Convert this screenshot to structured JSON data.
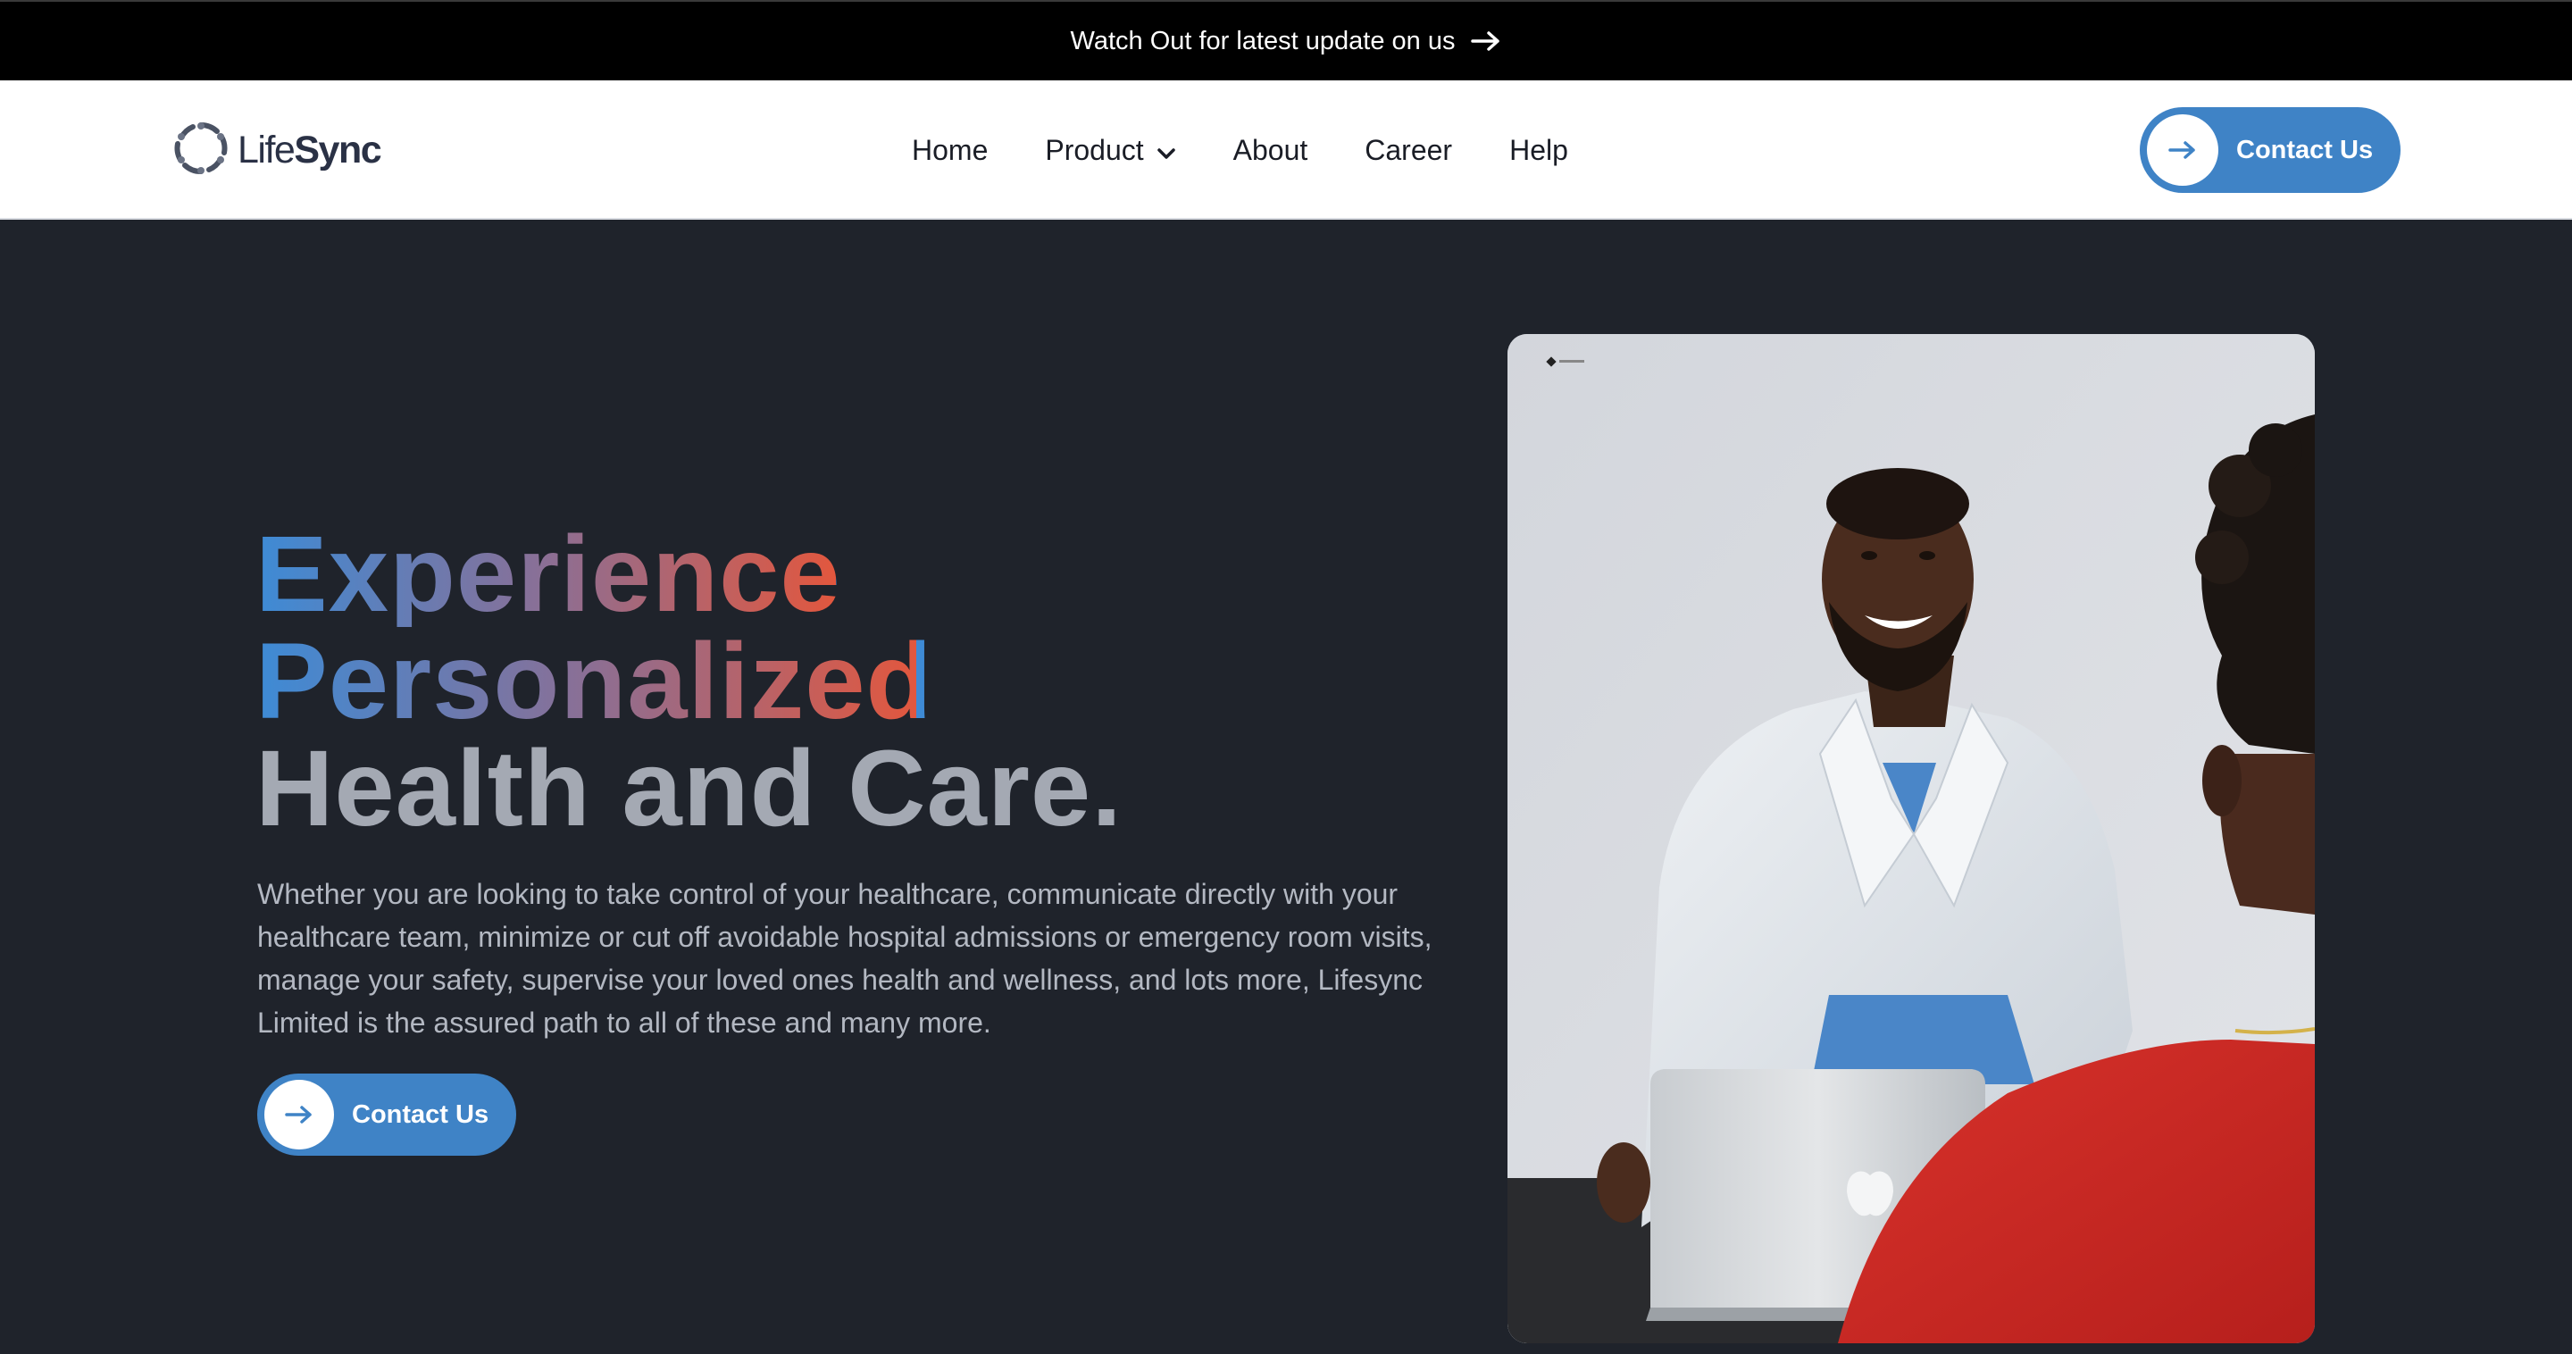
{
  "announcement": {
    "text": "Watch Out for latest update on us",
    "icon": "arrow-right-icon"
  },
  "nav": {
    "logo": {
      "light": "Life",
      "bold": "Sync",
      "icon": "lifesync-logo-icon"
    },
    "menu": [
      {
        "label": "Home"
      },
      {
        "label": "Product",
        "icon": "chevron-down-icon"
      },
      {
        "label": "About"
      },
      {
        "label": "Career"
      },
      {
        "label": "Help"
      }
    ],
    "cta": {
      "label": "Contact Us",
      "icon": "arrow-right-icon"
    }
  },
  "hero": {
    "title_line1": "Experience",
    "title_line2": "Personalized",
    "title_line3": "Health and Care.",
    "description": "Whether you are looking to take control of your healthcare, communicate directly with your healthcare team, minimize or cut off avoidable hospital admissions or emergency room visits, manage your safety, supervise your loved ones health and wellness, and lots more, Lifesync Limited is the assured path to all of these and many more.",
    "cta": {
      "label": "Contact Us",
      "icon": "arrow-right-icon"
    }
  },
  "colors": {
    "page_bg": "#1f232b",
    "accent": "#3f83c6",
    "gradient_start": "#3d8bd6",
    "gradient_end": "#e2573e",
    "announcement_bg": "#000000"
  }
}
